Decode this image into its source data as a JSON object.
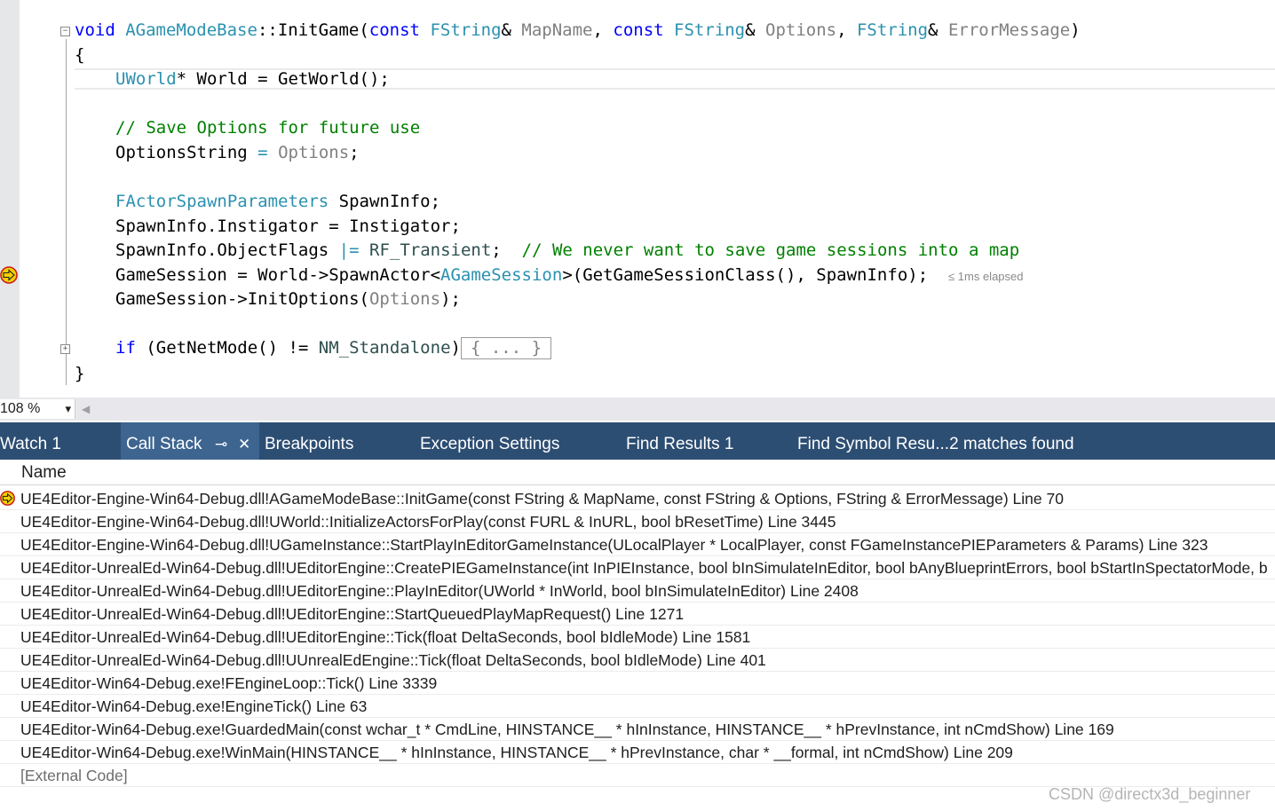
{
  "editor": {
    "lines": {
      "l1": {
        "kw_void": "void",
        "cls": "AGameModeBase",
        "scope": "::",
        "fn": "InitGame(",
        "kw_const1": "const",
        "ty1": "FString",
        "amp1": "& ",
        "p1": "MapName",
        "sep1": ", ",
        "kw_const2": "const",
        "ty2": "FString",
        "amp2": "& ",
        "p2": "Options",
        "sep2": ", ",
        "ty3": "FString",
        "amp3": "& ",
        "p3": "ErrorMessage",
        "close": ")"
      },
      "l2": {
        "text": "{"
      },
      "l3": {
        "ty": "UWorld",
        "rest": "* World = GetWorld();"
      },
      "l5": {
        "comment": "// Save Options for future use"
      },
      "l6": {
        "a": "OptionsString ",
        "eq": "=",
        "sp": " ",
        "param": "Options",
        "end": ";"
      },
      "l8": {
        "ty": "FActorSpawnParameters",
        "rest": " SpawnInfo;"
      },
      "l9": {
        "text": "SpawnInfo.Instigator = Instigator;"
      },
      "l10": {
        "a": "SpawnInfo.ObjectFlags ",
        "op": "|=",
        "sp": " ",
        "flag": "RF_Transient",
        "b": ";  ",
        "comment": "// We never want to save game sessions into a map"
      },
      "l11": {
        "a": "GameSession = World->SpawnActor<",
        "ty": "AGameSession",
        "b": ">(GetGameSessionClass(), SpawnInfo);",
        "elapsed": "≤ 1ms elapsed"
      },
      "l12": {
        "a": "GameSession->InitOptions(",
        "param": "Options",
        "b": ");"
      },
      "l14": {
        "kw": "if",
        "a": " (GetNetMode() != ",
        "en": "NM_Standalone",
        "b": ")",
        "collapsed": "{ ... }"
      },
      "l15": {
        "text": "}"
      }
    },
    "fold_minus": "−",
    "fold_plus": "+"
  },
  "status": {
    "zoom": "108 %",
    "zoom_dropdown": "▾",
    "scroll_left": "◀"
  },
  "tabs": {
    "watch": "Watch 1",
    "callstack": "Call Stack",
    "pin": "⊸",
    "close": "✕",
    "breakpoints": "Breakpoints",
    "exceptions": "Exception Settings",
    "find1": "Find Results 1",
    "findsym": "Find Symbol Resu...2 matches found"
  },
  "callstack": {
    "column_name": "Name",
    "frames": [
      "UE4Editor-Engine-Win64-Debug.dll!AGameModeBase::InitGame(const FString & MapName, const FString & Options, FString & ErrorMessage) Line 70",
      "UE4Editor-Engine-Win64-Debug.dll!UWorld::InitializeActorsForPlay(const FURL & InURL, bool bResetTime) Line 3445",
      "UE4Editor-Engine-Win64-Debug.dll!UGameInstance::StartPlayInEditorGameInstance(ULocalPlayer * LocalPlayer, const FGameInstancePIEParameters & Params) Line 323",
      "UE4Editor-UnrealEd-Win64-Debug.dll!UEditorEngine::CreatePIEGameInstance(int InPIEInstance, bool bInSimulateInEditor, bool bAnyBlueprintErrors, bool bStartInSpectatorMode, b",
      "UE4Editor-UnrealEd-Win64-Debug.dll!UEditorEngine::PlayInEditor(UWorld * InWorld, bool bInSimulateInEditor) Line 2408",
      "UE4Editor-UnrealEd-Win64-Debug.dll!UEditorEngine::StartQueuedPlayMapRequest() Line 1271",
      "UE4Editor-UnrealEd-Win64-Debug.dll!UEditorEngine::Tick(float DeltaSeconds, bool bIdleMode) Line 1581",
      "UE4Editor-UnrealEd-Win64-Debug.dll!UUnrealEdEngine::Tick(float DeltaSeconds, bool bIdleMode) Line 401",
      "UE4Editor-Win64-Debug.exe!FEngineLoop::Tick() Line 3339",
      "UE4Editor-Win64-Debug.exe!EngineTick() Line 63",
      "UE4Editor-Win64-Debug.exe!GuardedMain(const wchar_t * CmdLine, HINSTANCE__ * hInInstance, HINSTANCE__ * hPrevInstance, int nCmdShow) Line 169",
      "UE4Editor-Win64-Debug.exe!WinMain(HINSTANCE__ * hInInstance, HINSTANCE__ * hPrevInstance, char * __formal, int nCmdShow) Line 209",
      "[External Code]"
    ]
  },
  "watermark": "CSDN @directx3d_beginner",
  "colors": {
    "keyword": "#0000ff",
    "type": "#2b91af",
    "comment": "#008000",
    "param": "#808080",
    "tab_bar": "#2d4e73",
    "tab_active": "#3d6590",
    "breakpoint_arrow": "#f5d000"
  },
  "icons": {
    "current_statement": "current-statement-arrow-icon"
  }
}
